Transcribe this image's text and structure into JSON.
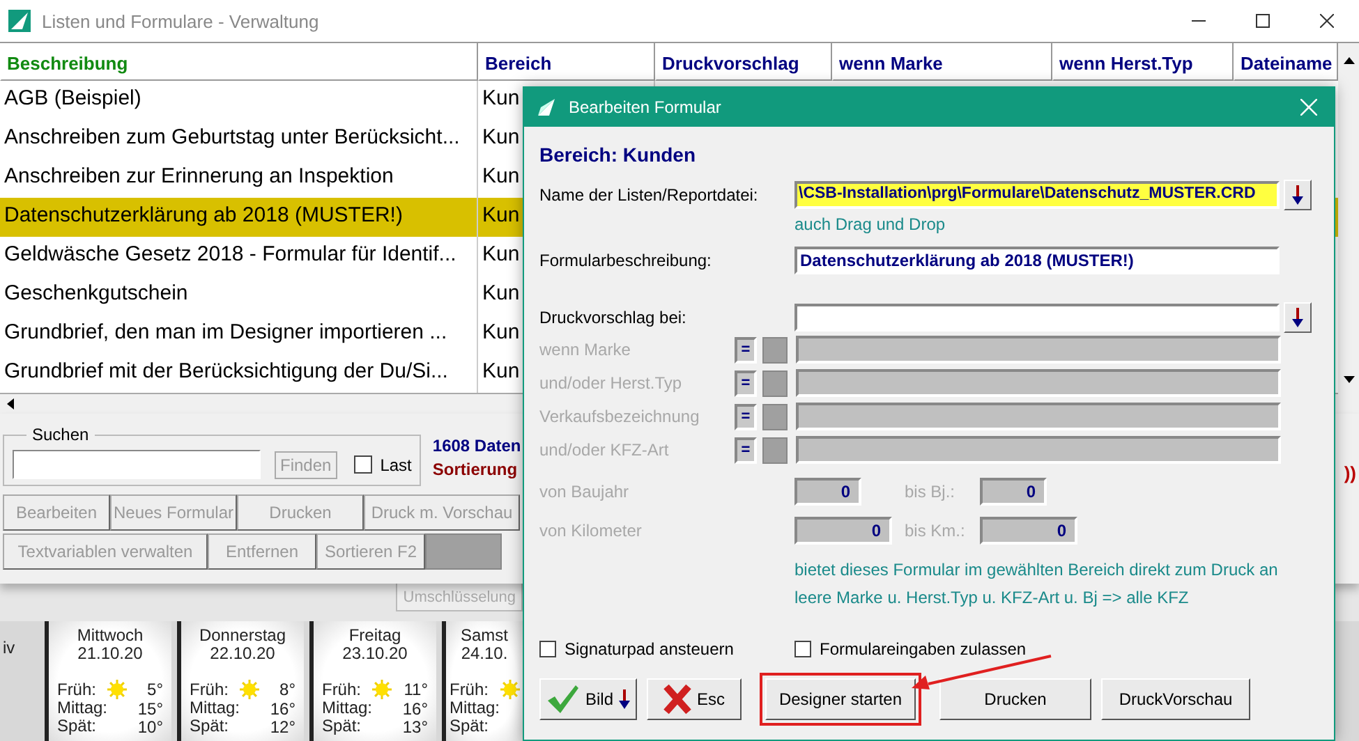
{
  "window": {
    "title": "Listen und Formulare - Verwaltung"
  },
  "table": {
    "columns": [
      {
        "label": "Beschreibung",
        "kind": "primary"
      },
      {
        "label": "Bereich",
        "kind": "normal"
      },
      {
        "label": "Druckvorschlag",
        "kind": "normal"
      },
      {
        "label": "wenn Marke",
        "kind": "normal"
      },
      {
        "label": "wenn Herst.Typ",
        "kind": "normal"
      },
      {
        "label": "Dateiname",
        "kind": "normal"
      }
    ],
    "rows": [
      {
        "cells": [
          "AGB (Beispiel)",
          "Kun"
        ],
        "selected": false
      },
      {
        "cells": [
          "Anschreiben zum Geburtstag unter Berücksicht...",
          "Kun"
        ],
        "selected": false
      },
      {
        "cells": [
          "Anschreiben zur Erinnerung an Inspektion",
          "Kun"
        ],
        "selected": false
      },
      {
        "cells": [
          "Datenschutzerklärung ab 2018 (MUSTER!)",
          "Kun"
        ],
        "selected": true
      },
      {
        "cells": [
          "Geldwäsche Gesetz 2018 - Formular für Identif...",
          "Kun"
        ],
        "selected": false
      },
      {
        "cells": [
          "Geschenkgutschein",
          "Kun"
        ],
        "selected": false
      },
      {
        "cells": [
          "Grundbrief, den man im Designer importieren ...",
          "Kun"
        ],
        "selected": false
      },
      {
        "cells": [
          "Grundbrief mit der Berücksichtigung der Du/Si...",
          "Kun"
        ],
        "selected": false
      }
    ]
  },
  "search": {
    "label": "Suchen",
    "button": "Finden",
    "last": {
      "label": "Last",
      "checked": false
    }
  },
  "info": {
    "count": "1608 Daten",
    "sort": "Sortierung",
    "extra": "))"
  },
  "buttons_row1": [
    {
      "label": "Bearbeiten"
    },
    {
      "label": "Neues Formular"
    },
    {
      "label": "Drucken"
    },
    {
      "label": "Druck m. Vorschau"
    }
  ],
  "buttons_row2": [
    {
      "label": "Textvariablen verwalten",
      "kind": "text"
    },
    {
      "label": "Entfernen",
      "kind": "text"
    },
    {
      "label": "Sortieren F2",
      "kind": "text"
    },
    {
      "kind": "blank"
    }
  ],
  "back_button": "Umschlüsselung",
  "weather": {
    "prefix": "iv",
    "days": [
      {
        "day": "Mittwoch",
        "date": "21.10.20",
        "lines": [
          {
            "label": "Früh:",
            "value": "5°"
          },
          {
            "label": "Mittag:",
            "value": "15°"
          },
          {
            "label": "Spät:",
            "value": "10°"
          }
        ]
      },
      {
        "day": "Donnerstag",
        "date": "22.10.20",
        "lines": [
          {
            "label": "Früh:",
            "value": "8°"
          },
          {
            "label": "Mittag:",
            "value": "16°"
          },
          {
            "label": "Spät:",
            "value": "12°"
          }
        ]
      },
      {
        "day": "Freitag",
        "date": "23.10.20",
        "lines": [
          {
            "label": "Früh:",
            "value": "11°"
          },
          {
            "label": "Mittag:",
            "value": "16°"
          },
          {
            "label": "Spät:",
            "value": "13°"
          }
        ]
      },
      {
        "day": "Samst",
        "date": "24.10.",
        "lines": [
          {
            "label": "Früh:"
          },
          {
            "label": "Mittag:"
          },
          {
            "label": "Spät:"
          }
        ]
      }
    ]
  },
  "dialog": {
    "title": "Bearbeiten Formular",
    "heading": "Bereich: Kunden",
    "file": {
      "label": "Name der Listen/Reportdatei:",
      "value": "\\CSB-Installation\\prg\\Formulare\\Datenschutz_MUSTER.CRD",
      "hint": "auch Drag und Drop"
    },
    "description": {
      "label": "Formularbeschreibung:",
      "value": "Datenschutzerklärung ab 2018 (MUSTER!)"
    },
    "suggest": {
      "label": "Druckvorschlag bei:"
    },
    "criteria": [
      {
        "label": "wenn Marke",
        "operator": "=",
        "disabled": true
      },
      {
        "label": "und/oder Herst.Typ",
        "operator": "=",
        "disabled": true
      },
      {
        "label": "Verkaufsbezeichnung",
        "operator": "=",
        "disabled": true
      },
      {
        "label": "und/oder KFZ-Art",
        "operator": "=",
        "disabled": true
      }
    ],
    "ranges": [
      {
        "label": "von Baujahr",
        "from": "0",
        "to_label": "bis Bj.:",
        "to": "0"
      },
      {
        "label": "von Kilometer",
        "from": "0",
        "to_label": "bis Km.:",
        "to": "0"
      }
    ],
    "note": [
      "bietet dieses Formular im gewählten Bereich direkt zum Druck an",
      "leere Marke u. Herst.Typ u. KFZ-Art u. Bj => alle KFZ"
    ],
    "checkboxes": [
      {
        "label": "Signaturpad ansteuern",
        "checked": false
      },
      {
        "label": "Formulareingaben zulassen",
        "checked": false
      }
    ],
    "buttons": [
      {
        "label": "Bild",
        "kind": "image",
        "highlighted": false
      },
      {
        "label": "Esc",
        "kind": "cancel",
        "highlighted": false
      },
      {
        "label": "Designer starten",
        "kind": "text",
        "highlighted": true
      },
      {
        "label": "Drucken",
        "kind": "text",
        "highlighted": false
      },
      {
        "label": "DruckVorschau",
        "kind": "text",
        "highlighted": false
      }
    ]
  }
}
